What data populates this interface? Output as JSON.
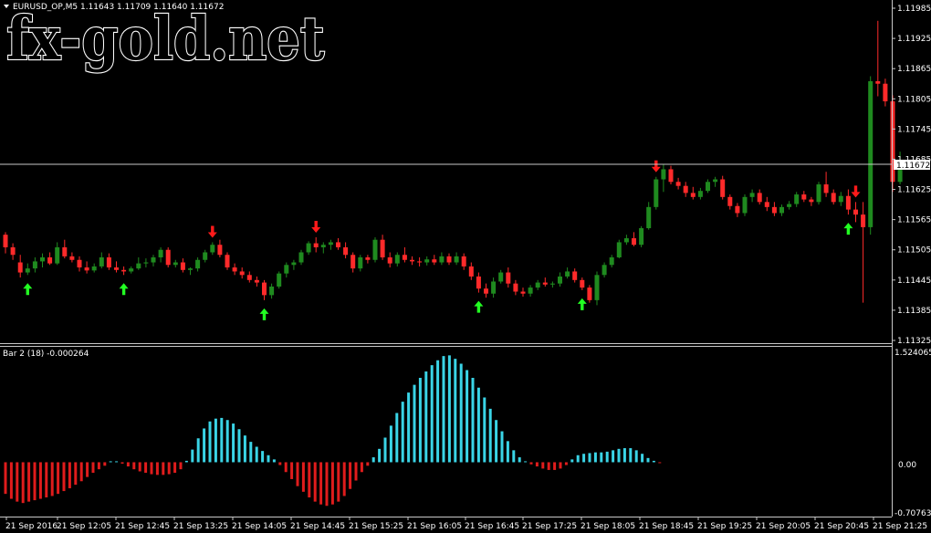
{
  "main": {
    "symbol_line": "EURUSD_OP,M5  1.11643 1.11709 1.11640 1.11672",
    "watermark": "fx-gold.net",
    "current_price": "1.11672",
    "price_axis": [
      "1.11985",
      "1.11925",
      "1.11865",
      "1.11805",
      "1.11745",
      "1.11685",
      "1.11625",
      "1.11565",
      "1.11505",
      "1.11445",
      "1.11385",
      "1.11325"
    ],
    "price_range": [
      1.11325,
      1.11985
    ]
  },
  "indicator": {
    "label": "Bar 2  (18)  -0.000264",
    "axis": [
      "1.524065",
      "0.00",
      "-0.707633"
    ],
    "range": [
      -0.707633,
      1.524065
    ],
    "positive_color": "#3ad4e6",
    "negative_color": "#e01c1c"
  },
  "time_axis": [
    "21 Sep 2016",
    "21 Sep 12:05",
    "21 Sep 12:45",
    "21 Sep 13:25",
    "21 Sep 14:05",
    "21 Sep 14:45",
    "21 Sep 15:25",
    "21 Sep 16:05",
    "21 Sep 16:45",
    "21 Sep 17:25",
    "21 Sep 18:05",
    "21 Sep 18:45",
    "21 Sep 19:25",
    "21 Sep 20:05",
    "21 Sep 20:45",
    "21 Sep 21:25"
  ],
  "colors": {
    "bull": "#1f8a1f",
    "bear": "#ff2a2a",
    "arrow_up": "#22ff22",
    "arrow_down": "#ff1a1a",
    "grid_line": "#c8c8c8"
  },
  "chart_data": {
    "type": "candlestick",
    "candles": [
      [
        1.11535,
        1.1154,
        1.11498,
        1.1151
      ],
      [
        1.1151,
        1.11518,
        1.11485,
        1.11495
      ],
      [
        1.1148,
        1.11495,
        1.1145,
        1.1146
      ],
      [
        1.1146,
        1.11478,
        1.11455,
        1.11468
      ],
      [
        1.11468,
        1.1149,
        1.1146,
        1.11482
      ],
      [
        1.11482,
        1.11498,
        1.1147,
        1.1149
      ],
      [
        1.1149,
        1.115,
        1.11475,
        1.11478
      ],
      [
        1.11478,
        1.1152,
        1.11475,
        1.1151
      ],
      [
        1.1151,
        1.11525,
        1.11488,
        1.11492
      ],
      [
        1.11492,
        1.115,
        1.1148,
        1.11485
      ],
      [
        1.11485,
        1.11492,
        1.11462,
        1.1147
      ],
      [
        1.1147,
        1.11482,
        1.11458,
        1.11464
      ],
      [
        1.11464,
        1.11478,
        1.1146,
        1.11472
      ],
      [
        1.11472,
        1.115,
        1.11468,
        1.1149
      ],
      [
        1.1149,
        1.11498,
        1.11465,
        1.1147
      ],
      [
        1.1147,
        1.11482,
        1.1146,
        1.11465
      ],
      [
        1.11465,
        1.11472,
        1.11455,
        1.11462
      ],
      [
        1.11462,
        1.11472,
        1.11458,
        1.11468
      ],
      [
        1.11468,
        1.1149,
        1.11465,
        1.11478
      ],
      [
        1.11478,
        1.11488,
        1.1147,
        1.1148
      ],
      [
        1.1148,
        1.11495,
        1.11472,
        1.1149
      ],
      [
        1.1149,
        1.1151,
        1.1148,
        1.11505
      ],
      [
        1.11505,
        1.1151,
        1.1147,
        1.11475
      ],
      [
        1.11475,
        1.11485,
        1.1147,
        1.1148
      ],
      [
        1.1148,
        1.11488,
        1.1146,
        1.11465
      ],
      [
        1.11465,
        1.1147,
        1.11455,
        1.11468
      ],
      [
        1.11468,
        1.1149,
        1.11462,
        1.11485
      ],
      [
        1.11485,
        1.11505,
        1.1148,
        1.115
      ],
      [
        1.115,
        1.1152,
        1.11495,
        1.11515
      ],
      [
        1.11515,
        1.11525,
        1.1149,
        1.11495
      ],
      [
        1.11495,
        1.115,
        1.11465,
        1.1147
      ],
      [
        1.1147,
        1.11478,
        1.11455,
        1.11462
      ],
      [
        1.11462,
        1.1147,
        1.11448,
        1.11455
      ],
      [
        1.11455,
        1.11462,
        1.1144,
        1.11445
      ],
      [
        1.11445,
        1.11452,
        1.11432,
        1.1144
      ],
      [
        1.1144,
        1.11445,
        1.11405,
        1.11415
      ],
      [
        1.11415,
        1.11438,
        1.11408,
        1.11432
      ],
      [
        1.11432,
        1.11462,
        1.11428,
        1.11458
      ],
      [
        1.11458,
        1.1148,
        1.1145,
        1.11475
      ],
      [
        1.11475,
        1.11485,
        1.11465,
        1.1148
      ],
      [
        1.1148,
        1.11505,
        1.11475,
        1.115
      ],
      [
        1.115,
        1.11522,
        1.11495,
        1.11518
      ],
      [
        1.11518,
        1.1153,
        1.115,
        1.1151
      ],
      [
        1.1151,
        1.1152,
        1.11498,
        1.11515
      ],
      [
        1.11515,
        1.11525,
        1.11505,
        1.1152
      ],
      [
        1.1152,
        1.11528,
        1.11505,
        1.1151
      ],
      [
        1.1151,
        1.1152,
        1.11488,
        1.11495
      ],
      [
        1.11495,
        1.115,
        1.1146,
        1.11468
      ],
      [
        1.11468,
        1.11495,
        1.11462,
        1.1149
      ],
      [
        1.1149,
        1.11495,
        1.11478,
        1.11485
      ],
      [
        1.11485,
        1.1153,
        1.1148,
        1.11525
      ],
      [
        1.11525,
        1.11535,
        1.11485,
        1.1149
      ],
      [
        1.1149,
        1.115,
        1.1147,
        1.11478
      ],
      [
        1.11478,
        1.115,
        1.11472,
        1.11495
      ],
      [
        1.11495,
        1.1151,
        1.1148,
        1.11485
      ],
      [
        1.11485,
        1.11492,
        1.11475,
        1.11482
      ],
      [
        1.11482,
        1.1149,
        1.11472,
        1.1148
      ],
      [
        1.1148,
        1.11492,
        1.11474,
        1.11486
      ],
      [
        1.11486,
        1.11495,
        1.11475,
        1.1148
      ],
      [
        1.1148,
        1.115,
        1.11475,
        1.11492
      ],
      [
        1.11492,
        1.11498,
        1.11475,
        1.1148
      ],
      [
        1.1148,
        1.115,
        1.11475,
        1.11492
      ],
      [
        1.11492,
        1.11498,
        1.11465,
        1.11472
      ],
      [
        1.11472,
        1.1148,
        1.11445,
        1.11452
      ],
      [
        1.11452,
        1.1146,
        1.1142,
        1.11428
      ],
      [
        1.11428,
        1.11438,
        1.1141,
        1.11418
      ],
      [
        1.11418,
        1.1145,
        1.1141,
        1.11442
      ],
      [
        1.11442,
        1.11465,
        1.11438,
        1.1146
      ],
      [
        1.1146,
        1.1147,
        1.1143,
        1.11438
      ],
      [
        1.11438,
        1.11445,
        1.11415,
        1.11422
      ],
      [
        1.11422,
        1.1143,
        1.11412,
        1.11418
      ],
      [
        1.11418,
        1.11435,
        1.11412,
        1.1143
      ],
      [
        1.1143,
        1.11445,
        1.11425,
        1.1144
      ],
      [
        1.1144,
        1.1145,
        1.11432,
        1.11436
      ],
      [
        1.11436,
        1.11442,
        1.1143,
        1.11438
      ],
      [
        1.11438,
        1.1146,
        1.11432,
        1.11452
      ],
      [
        1.11452,
        1.1147,
        1.11448,
        1.11462
      ],
      [
        1.11462,
        1.11468,
        1.1144,
        1.11445
      ],
      [
        1.11445,
        1.1145,
        1.11425,
        1.1143
      ],
      [
        1.1143,
        1.11435,
        1.114,
        1.11405
      ],
      [
        1.11405,
        1.11462,
        1.11395,
        1.11455
      ],
      [
        1.11455,
        1.1148,
        1.1145,
        1.11475
      ],
      [
        1.11475,
        1.11495,
        1.1147,
        1.1149
      ],
      [
        1.1149,
        1.11525,
        1.11488,
        1.1152
      ],
      [
        1.1152,
        1.11535,
        1.11515,
        1.11528
      ],
      [
        1.11528,
        1.1154,
        1.11512,
        1.11515
      ],
      [
        1.11515,
        1.11552,
        1.1151,
        1.11548
      ],
      [
        1.11548,
        1.116,
        1.11545,
        1.1159
      ],
      [
        1.1159,
        1.1165,
        1.11585,
        1.11645
      ],
      [
        1.11645,
        1.11675,
        1.1162,
        1.11665
      ],
      [
        1.11665,
        1.11672,
        1.11635,
        1.1164
      ],
      [
        1.1164,
        1.11648,
        1.11625,
        1.11632
      ],
      [
        1.11632,
        1.1164,
        1.1161,
        1.11618
      ],
      [
        1.11618,
        1.1163,
        1.11605,
        1.1161
      ],
      [
        1.1161,
        1.11628,
        1.11605,
        1.11622
      ],
      [
        1.11622,
        1.11645,
        1.11618,
        1.1164
      ],
      [
        1.1164,
        1.1165,
        1.1163,
        1.11645
      ],
      [
        1.11645,
        1.11652,
        1.11605,
        1.1161
      ],
      [
        1.1161,
        1.11615,
        1.11585,
        1.11592
      ],
      [
        1.11592,
        1.11598,
        1.1157,
        1.11578
      ],
      [
        1.11578,
        1.11615,
        1.11572,
        1.1161
      ],
      [
        1.1161,
        1.11625,
        1.116,
        1.11618
      ],
      [
        1.11618,
        1.11625,
        1.11595,
        1.116
      ],
      [
        1.116,
        1.1161,
        1.11582,
        1.1159
      ],
      [
        1.1159,
        1.116,
        1.11572,
        1.11578
      ],
      [
        1.11578,
        1.11595,
        1.11572,
        1.1159
      ],
      [
        1.1159,
        1.11602,
        1.11585,
        1.11596
      ],
      [
        1.11596,
        1.1162,
        1.1159,
        1.11615
      ],
      [
        1.11615,
        1.11622,
        1.116,
        1.11605
      ],
      [
        1.11605,
        1.1161,
        1.11592,
        1.116
      ],
      [
        1.116,
        1.1164,
        1.11595,
        1.11635
      ],
      [
        1.11635,
        1.1166,
        1.1161,
        1.11618
      ],
      [
        1.11618,
        1.11625,
        1.11595,
        1.116
      ],
      [
        1.116,
        1.1162,
        1.11592,
        1.11612
      ],
      [
        1.11612,
        1.11625,
        1.11575,
        1.11585
      ],
      [
        1.11585,
        1.116,
        1.1156,
        1.11575
      ],
      [
        1.11575,
        1.116,
        1.114,
        1.1155
      ],
      [
        1.1155,
        1.1185,
        1.11535,
        1.1184
      ],
      [
        1.1184,
        1.1196,
        1.1181,
        1.11835
      ],
      [
        1.11835,
        1.11845,
        1.1179,
        1.118
      ],
      [
        1.118,
        1.11812,
        1.1162,
        1.1164
      ],
      [
        1.1164,
        1.117,
        1.11635,
        1.11672
      ]
    ],
    "arrows_up_index": [
      3,
      16,
      35,
      64,
      78,
      114
    ],
    "arrows_down_index": [
      28,
      42,
      88,
      115
    ],
    "indicator_values": [
      -0.45,
      -0.52,
      -0.56,
      -0.58,
      -0.56,
      -0.54,
      -0.52,
      -0.5,
      -0.48,
      -0.45,
      -0.41,
      -0.37,
      -0.32,
      -0.27,
      -0.21,
      -0.15,
      -0.1,
      -0.05,
      0.0,
      0.0,
      -0.02,
      -0.06,
      -0.1,
      -0.13,
      -0.15,
      -0.17,
      -0.18,
      -0.18,
      -0.17,
      -0.15,
      -0.1,
      0.02,
      0.18,
      0.34,
      0.48,
      0.58,
      0.62,
      0.63,
      0.6,
      0.55,
      0.47,
      0.38,
      0.29,
      0.22,
      0.16,
      0.1,
      0.04,
      -0.04,
      -0.14,
      -0.24,
      -0.34,
      -0.42,
      -0.5,
      -0.56,
      -0.6,
      -0.62,
      -0.6,
      -0.56,
      -0.48,
      -0.38,
      -0.26,
      -0.14,
      -0.05,
      0.07,
      0.19,
      0.35,
      0.52,
      0.7,
      0.86,
      0.99,
      1.1,
      1.2,
      1.29,
      1.38,
      1.45,
      1.51,
      1.52,
      1.47,
      1.4,
      1.31,
      1.2,
      1.06,
      0.92,
      0.76,
      0.6,
      0.44,
      0.3,
      0.17,
      0.07,
      0.0,
      -0.03,
      -0.06,
      -0.09,
      -0.11,
      -0.11,
      -0.09,
      -0.04,
      0.04,
      0.1,
      0.12,
      0.13,
      0.14,
      0.14,
      0.15,
      0.17,
      0.19,
      0.2,
      0.2,
      0.17,
      0.12,
      0.06,
      0.02,
      -0.01
    ]
  }
}
